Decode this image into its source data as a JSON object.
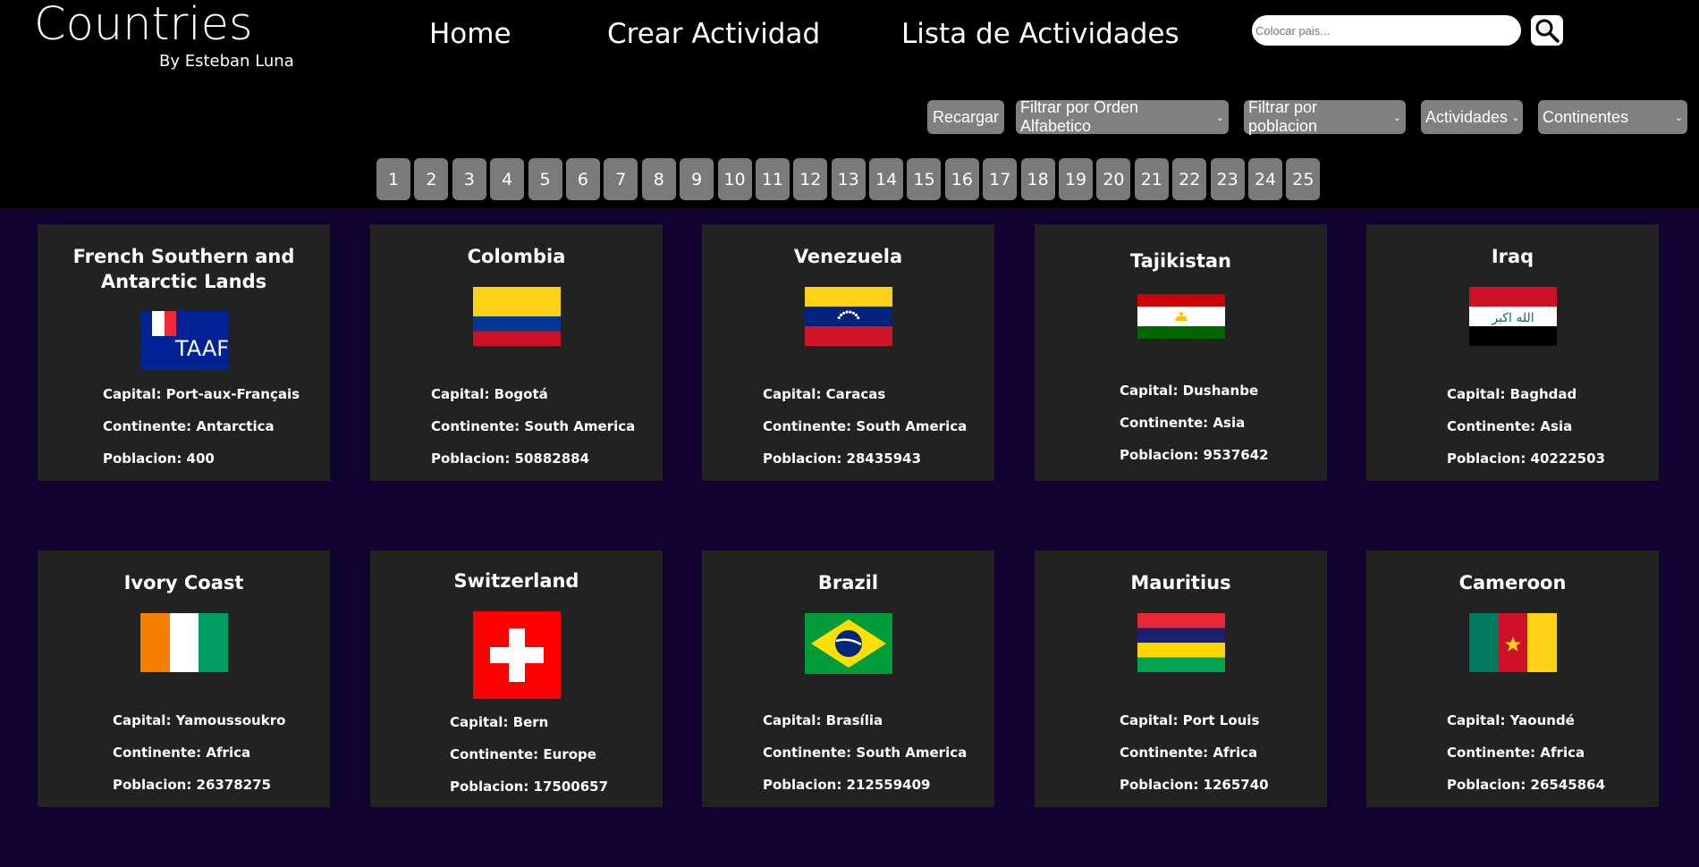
{
  "brand": {
    "title": "Countries",
    "subtitle": "By Esteban Luna"
  },
  "nav": {
    "home": "Home",
    "create": "Crear Actividad",
    "list": "Lista de Actividades"
  },
  "search": {
    "placeholder": "Colocar pais...",
    "value": ""
  },
  "filters": {
    "reload": "Recargar",
    "alpha": "Filtrar por Orden Alfabetico",
    "population": "Filtrar por poblacion",
    "activities": "Actividades",
    "continents": "Continentes"
  },
  "pages": [
    "1",
    "2",
    "3",
    "4",
    "5",
    "6",
    "7",
    "8",
    "9",
    "10",
    "11",
    "12",
    "13",
    "14",
    "15",
    "16",
    "17",
    "18",
    "19",
    "20",
    "21",
    "22",
    "23",
    "24",
    "25"
  ],
  "labels": {
    "capital": "Capital: ",
    "continent": "Continente: ",
    "population": "Poblacion: "
  },
  "countries": [
    {
      "name": "French Southern and Antarctic Lands",
      "capital": "Port-aux-Français",
      "continent": "Antarctica",
      "population": "400",
      "flag": "atf-flag"
    },
    {
      "name": "Colombia",
      "capital": "Bogotá",
      "continent": "South America",
      "population": "50882884",
      "flag": "colombia-flag"
    },
    {
      "name": "Venezuela",
      "capital": "Caracas",
      "continent": "South America",
      "population": "28435943",
      "flag": "venezuela-flag"
    },
    {
      "name": "Tajikistan",
      "capital": "Dushanbe",
      "continent": "Asia",
      "population": "9537642",
      "flag": "tajikistan-flag"
    },
    {
      "name": "Iraq",
      "capital": "Baghdad",
      "continent": "Asia",
      "population": "40222503",
      "flag": "iraq-flag"
    },
    {
      "name": "Ivory Coast",
      "capital": "Yamoussoukro",
      "continent": "Africa",
      "population": "26378275",
      "flag": "ivory-coast-flag"
    },
    {
      "name": "Switzerland",
      "capital": "Bern",
      "continent": "Europe",
      "population": "17500657",
      "flag": "switzerland-flag"
    },
    {
      "name": "Brazil",
      "capital": "Brasília",
      "continent": "South America",
      "population": "212559409",
      "flag": "brazil-flag"
    },
    {
      "name": "Mauritius",
      "capital": "Port Louis",
      "continent": "Africa",
      "population": "1265740",
      "flag": "mauritius-flag"
    },
    {
      "name": "Cameroon",
      "capital": "Yaoundé",
      "continent": "Africa",
      "population": "26545864",
      "flag": "cameroon-flag"
    }
  ],
  "colors": {
    "header": "#000000",
    "background": "#10032f",
    "card": "#222222",
    "button": "#808080"
  }
}
